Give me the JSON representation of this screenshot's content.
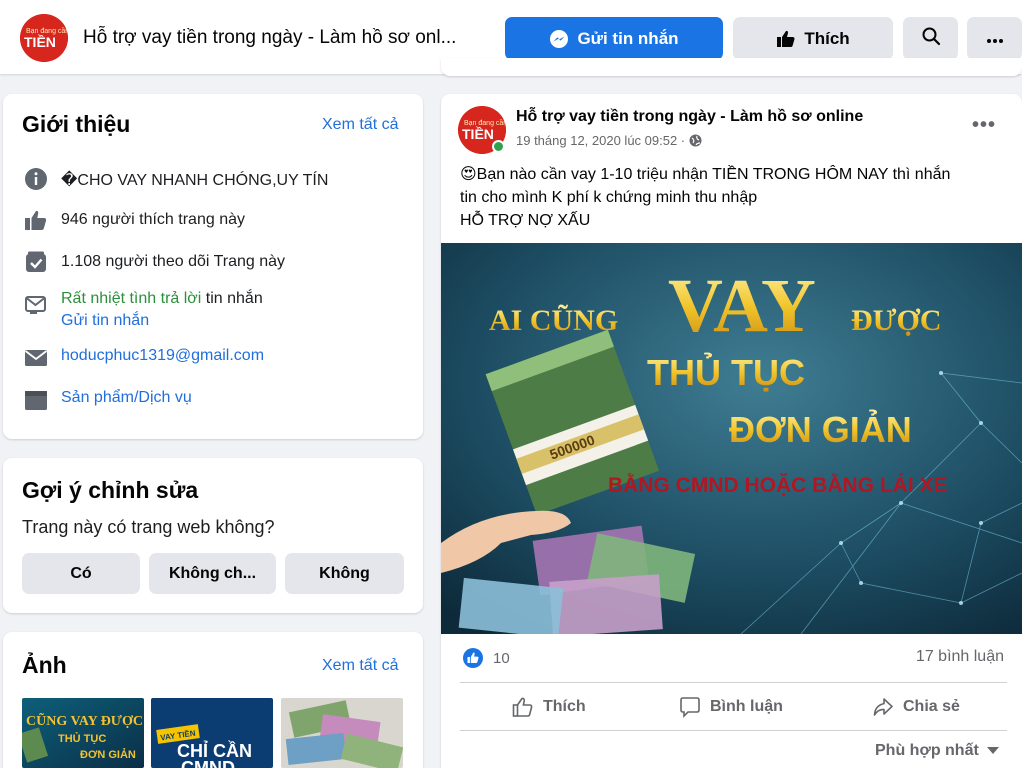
{
  "header": {
    "title": "Hỗ trợ vay tiền trong ngày - Làm hồ sơ onl...",
    "avatar_text": "TIỀN",
    "avatar_small_text": "Bạn đang cần",
    "message_button": "Gửi tin nhắn",
    "like_button": "Thích",
    "search_icon": "search-icon",
    "more_icon": "more-icon"
  },
  "intro": {
    "heading": "Giới thiệu",
    "see_all": "Xem tất cả",
    "description": "�CHO VAY NHANH CHÓNG,UY TÍN",
    "likes": "946 người thích trang này",
    "followers": "1.108 người theo dõi Trang này",
    "response_highlight": "Rất nhiệt tình trả lời",
    "response_rest": " tin nhắn",
    "send_message_link": "Gửi tin nhắn",
    "email": "hoducphuc1319@gmail.com",
    "category": "Sản phẩm/Dịch vụ"
  },
  "suggest": {
    "heading": "Gợi ý chỉnh sửa",
    "question": "Trang này có trang web không?",
    "yes": "Có",
    "unsure": "Không ch...",
    "no": "Không"
  },
  "photos": {
    "heading": "Ảnh",
    "see_all": "Xem tất cả",
    "thumb1_line1": "CŨNG VAY ĐƯỢC",
    "thumb1_line2": "THỦ TỤC",
    "thumb1_line3": "ĐƠN GIẢN",
    "thumb2_tag": "VAY TIỀN",
    "thumb2_line1": "CHỈ CẦN",
    "thumb2_line2": "CMND"
  },
  "post": {
    "author": "Hỗ trợ vay tiền trong ngày - Làm hồ sơ online",
    "timestamp": "19 tháng 12, 2020 lúc 09:52 ·",
    "line1": "😍Bạn nào cần vay 1-10 triệu nhận TIỀN TRONG HÔM NAY thì nhắn",
    "line2": "tin cho mình K phí k chứng minh thu nhập",
    "line3": "HỖ TRỢ NỢ XẤU",
    "image": {
      "line1_a": "AI CŨNG",
      "line1_big": "VAY",
      "line1_b": "ĐƯỢC",
      "line2": "THỦ TỤC",
      "line3": "ĐƠN GIẢN",
      "line4": "BẰNG CMND HOẶC BẰNG LÁI XE",
      "note_value": "500000"
    },
    "reactions": "10",
    "comments": "17 bình luận",
    "like_action": "Thích",
    "comment_action": "Bình luận",
    "share_action": "Chia sẻ",
    "sort": "Phù hợp nhất"
  },
  "colors": {
    "accent": "#1b74e4",
    "link": "#216fdb",
    "green": "#2d8f3c",
    "brand_red": "#d7261e"
  }
}
